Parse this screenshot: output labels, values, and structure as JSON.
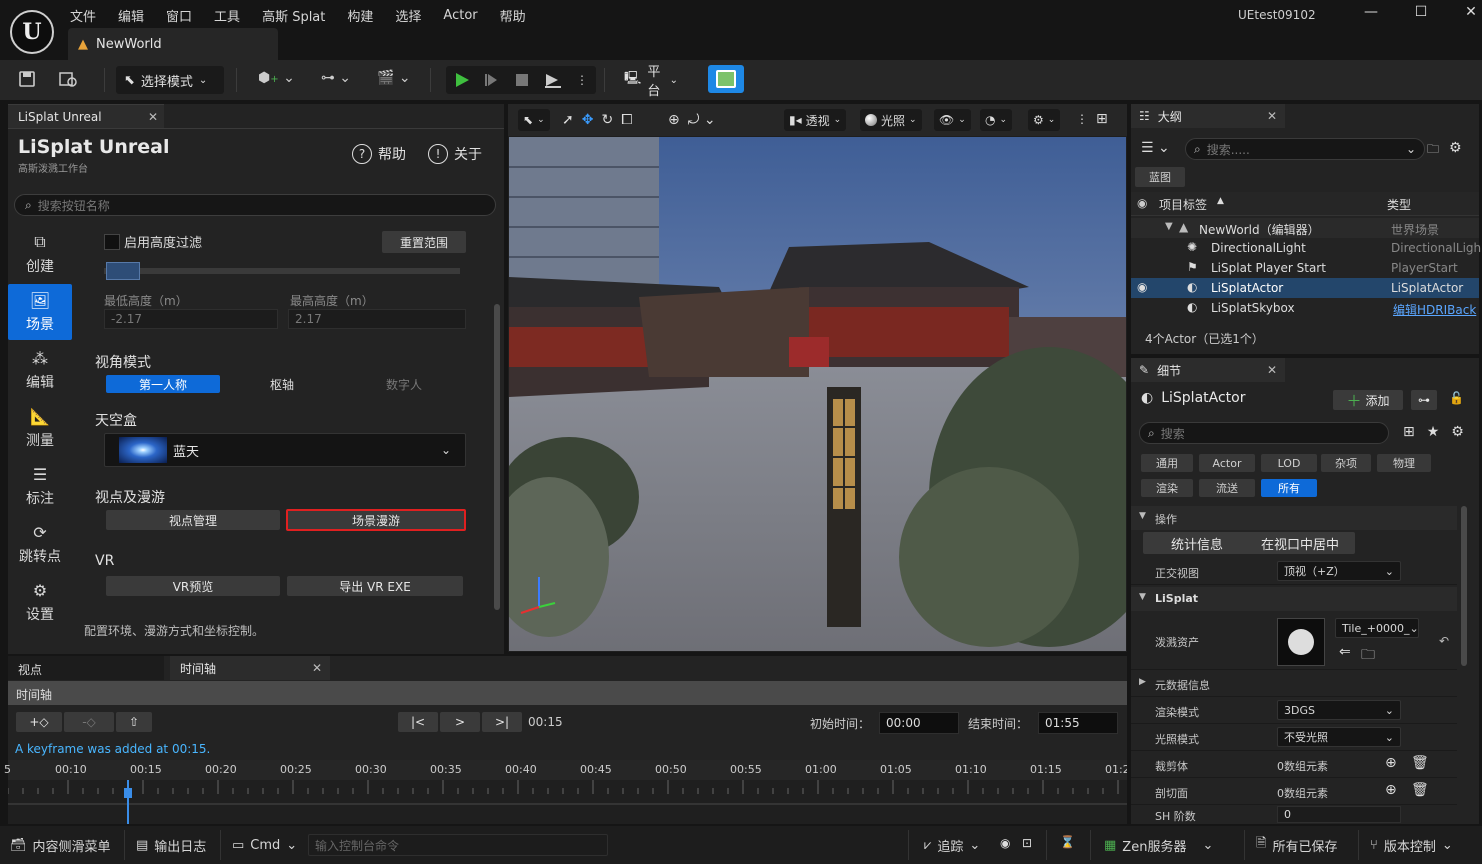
{
  "menu": {
    "items": [
      "文件",
      "编辑",
      "窗口",
      "工具",
      "高斯 Splat",
      "构建",
      "选择",
      "Actor",
      "帮助"
    ],
    "project": "UEtest09102",
    "doc_tab": "NewWorld"
  },
  "toolbar": {
    "select_mode": "选择模式",
    "platform": "平台"
  },
  "left_panel": {
    "tab": "LiSplat Unreal",
    "title": "LiSplat Unreal",
    "subtitle": "高斯泼溅工作台",
    "help": "帮助",
    "about": "关于",
    "search_placeholder": "搜索按钮名称",
    "nav": [
      "创建",
      "场景",
      "编辑",
      "测量",
      "标注",
      "跳转点",
      "设置"
    ],
    "height_filter": "启用高度过滤",
    "reset_range": "重置范围",
    "min_height_label": "最低高度（m）",
    "max_height_label": "最高高度（m）",
    "min_height": "-2.17",
    "max_height": "2.17",
    "view_mode_title": "视角模式",
    "view_modes": [
      "第一人称",
      "枢轴",
      "数字人"
    ],
    "skybox_title": "天空盒",
    "skybox_value": "蓝天",
    "viewpoint_title": "视点及漫游",
    "viewpoint_mgmt": "视点管理",
    "scene_tour": "场景漫游",
    "vr_title": "VR",
    "vr_preview": "VR预览",
    "export_vr": "导出 VR EXE",
    "footer": "配置环境、漫游方式和坐标控制。"
  },
  "viewport": {
    "perspective": "透视",
    "lighting": "光照"
  },
  "outliner": {
    "tab": "大纲",
    "search_placeholder": "搜索.....",
    "blueprint": "蓝图",
    "col_label": "项目标签",
    "col_type": "类型",
    "rows": [
      {
        "label": "NewWorld（编辑器）",
        "type": "世界场景"
      },
      {
        "label": "DirectionalLight",
        "type": "DirectionalLigh"
      },
      {
        "label": "LiSplat Player Start",
        "type": "PlayerStart"
      },
      {
        "label": "LiSplatActor",
        "type": "LiSplatActor"
      },
      {
        "label": "LiSplatSkybox",
        "type": "编辑HDRIBack"
      }
    ],
    "count": "4个Actor（已选1个）"
  },
  "details": {
    "tab": "细节",
    "actor": "LiSplatActor",
    "add": "添加",
    "search_placeholder": "搜索",
    "filters": [
      "通用",
      "Actor",
      "LOD",
      "杂项",
      "物理",
      "渲染",
      "流送",
      "所有"
    ],
    "section_ops": "操作",
    "stats": "统计信息",
    "center": "在视口中居中",
    "ortho_label": "正交视图",
    "ortho_value": "顶视（+Z）",
    "section_lisplat": "LiSplat",
    "splat_asset": "泼溅资产",
    "asset_value": "Tile_+0000_",
    "metadata": "元数据信息",
    "render_mode_label": "渲染模式",
    "render_mode": "3DGS",
    "light_mode_label": "光照模式",
    "light_mode": "不受光照",
    "clip_label": "裁剪体",
    "clip_value": "0数组元素",
    "section_label": "剖切面",
    "section_value": "0数组元素",
    "sh_label": "SH 阶数",
    "sh_value": "0"
  },
  "timeline": {
    "tab1": "视点",
    "tab2": "时间轴",
    "header": "时间轴",
    "current": "00:15",
    "start_label": "初始时间：",
    "start": "00:00",
    "end_label": "结束时间：",
    "end": "01:55",
    "message": "A keyframe was added at 00:15.",
    "ticks": [
      "00:10",
      "00:15",
      "00:20",
      "00:25",
      "00:30",
      "00:35",
      "00:40",
      "00:45",
      "00:50",
      "00:55",
      "01:00",
      "01:05",
      "01:10",
      "01:15",
      "01:2"
    ]
  },
  "status": {
    "drawer": "内容侧滑菜单",
    "log": "输出日志",
    "cmd": "Cmd",
    "cmd_placeholder": "输入控制台命令",
    "trace": "追踪",
    "zen": "Zen服务器",
    "saved": "所有已保存",
    "vcs": "版本控制"
  }
}
